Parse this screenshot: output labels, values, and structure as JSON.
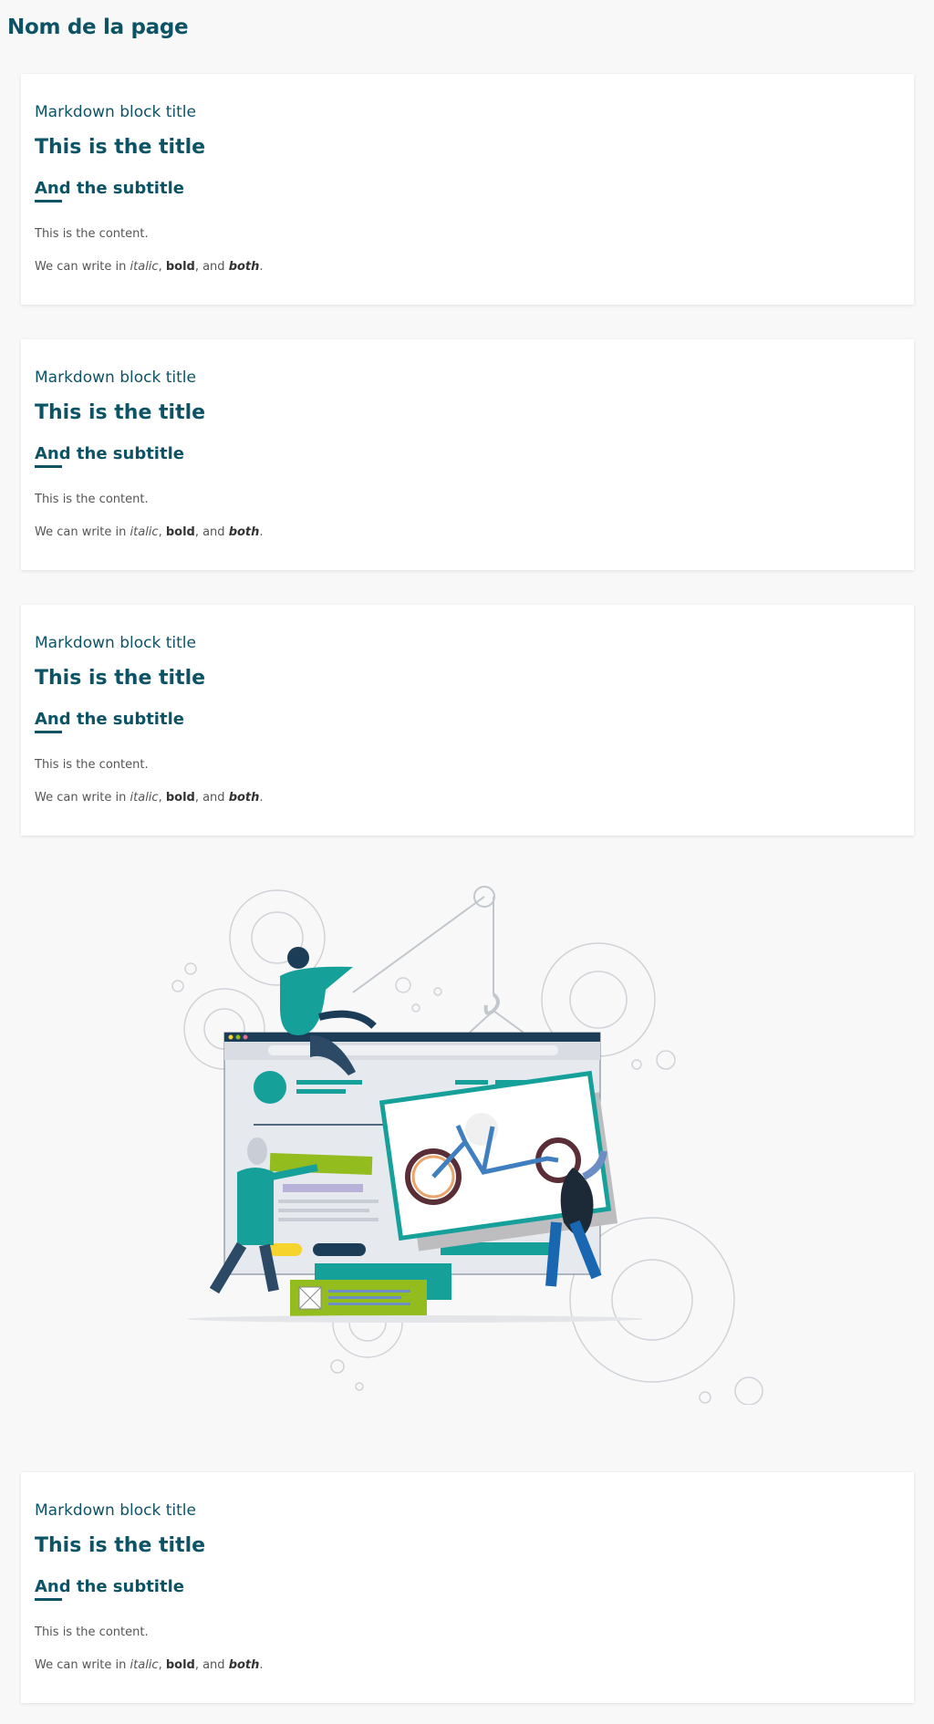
{
  "page": {
    "title": "Nom de la page"
  },
  "cards": [
    {
      "block_title": "Markdown block title",
      "title": "This is the title",
      "subtitle": "And the subtitle",
      "content": "This is the content.",
      "rich": {
        "prefix": "We can write in ",
        "italic": "italic",
        "sep1": ", ",
        "bold": "bold",
        "sep2": ", and ",
        "both": "both",
        "suffix": "."
      }
    },
    {
      "block_title": "Markdown block title",
      "title": "This is the title",
      "subtitle": "And the subtitle",
      "content": "This is the content.",
      "rich": {
        "prefix": "We can write in ",
        "italic": "italic",
        "sep1": ", ",
        "bold": "bold",
        "sep2": ", and ",
        "both": "both",
        "suffix": "."
      }
    },
    {
      "block_title": "Markdown block title",
      "title": "This is the title",
      "subtitle": "And the subtitle",
      "content": "This is the content.",
      "rich": {
        "prefix": "We can write in ",
        "italic": "italic",
        "sep1": ", ",
        "bold": "bold",
        "sep2": ", and ",
        "both": "both",
        "suffix": "."
      }
    },
    {
      "block_title": "Markdown block title",
      "title": "This is the title",
      "subtitle": "And the subtitle",
      "content": "This is the content.",
      "rich": {
        "prefix": "We can write in ",
        "italic": "italic",
        "sep1": ", ",
        "bold": "bold",
        "sep2": ", and ",
        "both": "both",
        "suffix": "."
      }
    }
  ],
  "illustration": {
    "icons": [
      "gear-icon",
      "browser-window",
      "bicycle-picture",
      "crane-hook-icon"
    ]
  },
  "colors": {
    "primary": "#0d5366",
    "teal": "#16a09a",
    "lime": "#93bd1f",
    "navy": "#1c3d57",
    "background": "#f8f8f8"
  }
}
